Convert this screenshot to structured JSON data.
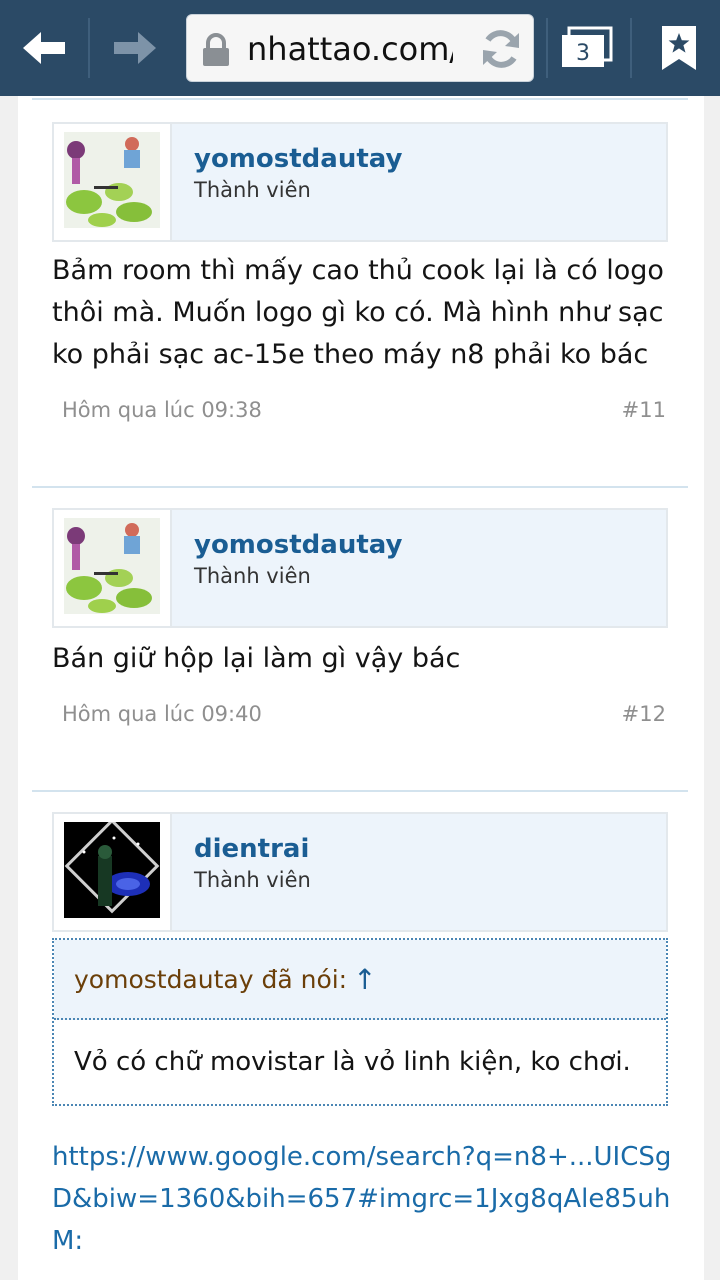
{
  "browser": {
    "url": "nhattao.com/threads/",
    "tab_count": "3"
  },
  "posts": [
    {
      "username": "yomostdautay",
      "user_title": "Thành viên",
      "message": "Bảm room thì mấy cao thủ cook lại là có logo thôi mà. Muốn logo gì ko có. Mà hình như sạc ko phải sạc ac-15e theo máy n8 phải ko bác",
      "date": "Hôm qua lúc 09:38",
      "number": "#11"
    },
    {
      "username": "yomostdautay",
      "user_title": "Thành viên",
      "message": "Bán giữ hộp lại làm gì vậy bác",
      "date": "Hôm qua lúc 09:40",
      "number": "#12"
    },
    {
      "username": "dientrai",
      "user_title": "Thành viên",
      "quote_author": "yomostdautay đã nói:",
      "quote_arrow": "↑",
      "quote_text": "Vỏ có chữ movistar là vỏ linh kiện, ko chơi.",
      "link": "https://www.google.com/search?q=n8+...UICSgD&biw=1360&bih=657#imgrc=1Jxg8qAle85uhM:"
    }
  ]
}
